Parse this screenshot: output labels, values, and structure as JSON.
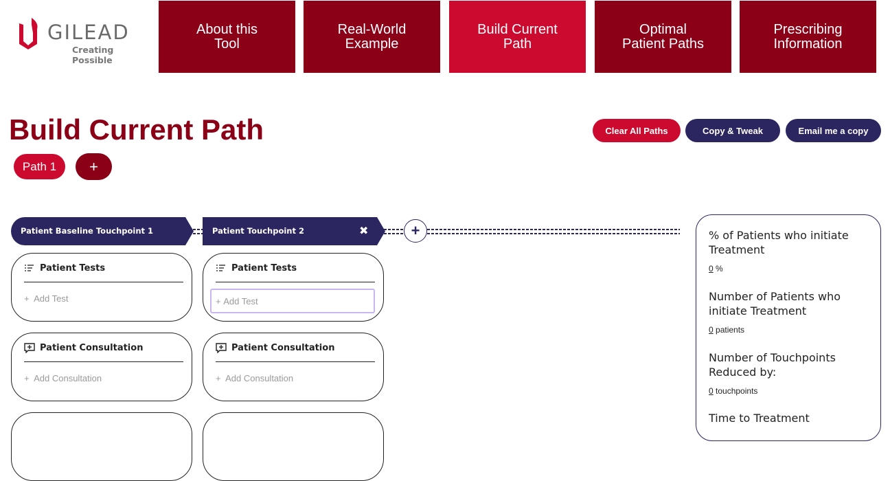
{
  "brand": {
    "name": "GILEAD",
    "tagline": "Creating Possible"
  },
  "nav": [
    {
      "label": "About this\nTool",
      "active": false
    },
    {
      "label": "Real-World\nExample",
      "active": false
    },
    {
      "label": "Build Current\nPath",
      "active": true
    },
    {
      "label": "Optimal\nPatient Paths",
      "active": false
    },
    {
      "label": "Prescribing\nInformation",
      "active": false
    }
  ],
  "page_title": "Build Current Path",
  "actions": {
    "clear": "Clear All Paths",
    "copy": "Copy & Tweak",
    "email": "Email me a copy"
  },
  "paths": {
    "tab1": "Path 1",
    "add": "+"
  },
  "touchpoints": [
    {
      "label": "Patient Baseline Touchpoint 1",
      "tests_title": "Patient Tests",
      "tests_add": "Add Test",
      "consult_title": "Patient Consultation",
      "consult_add": "Add Consultation"
    },
    {
      "label": "Patient Touchpoint 2",
      "close": "✖",
      "tests_title": "Patient Tests",
      "tests_add": "Add Test",
      "consult_title": "Patient Consultation",
      "consult_add": "Add Consultation"
    }
  ],
  "add_touchpoint": "+",
  "add_prefix": "+",
  "stats": [
    {
      "label": "% of Patients who initiate Treatment",
      "value": "0",
      "unit": "%"
    },
    {
      "label": "Number of Patients who initiate Treatment",
      "value": "0",
      "unit": "patients"
    },
    {
      "label": "Number of Touchpoints Reduced by:",
      "value": "0",
      "unit": "touchpoints"
    },
    {
      "label": "Time to Treatment",
      "value": "",
      "unit": ""
    }
  ],
  "colors": {
    "dark_red": "#8b0017",
    "bright_red": "#cc0a2f",
    "navy": "#2b2560",
    "focus_outline": "#c9b5f0"
  },
  "icons": {
    "tests": "tests-list-icon",
    "consult": "consultation-icon",
    "close": "close-icon"
  }
}
